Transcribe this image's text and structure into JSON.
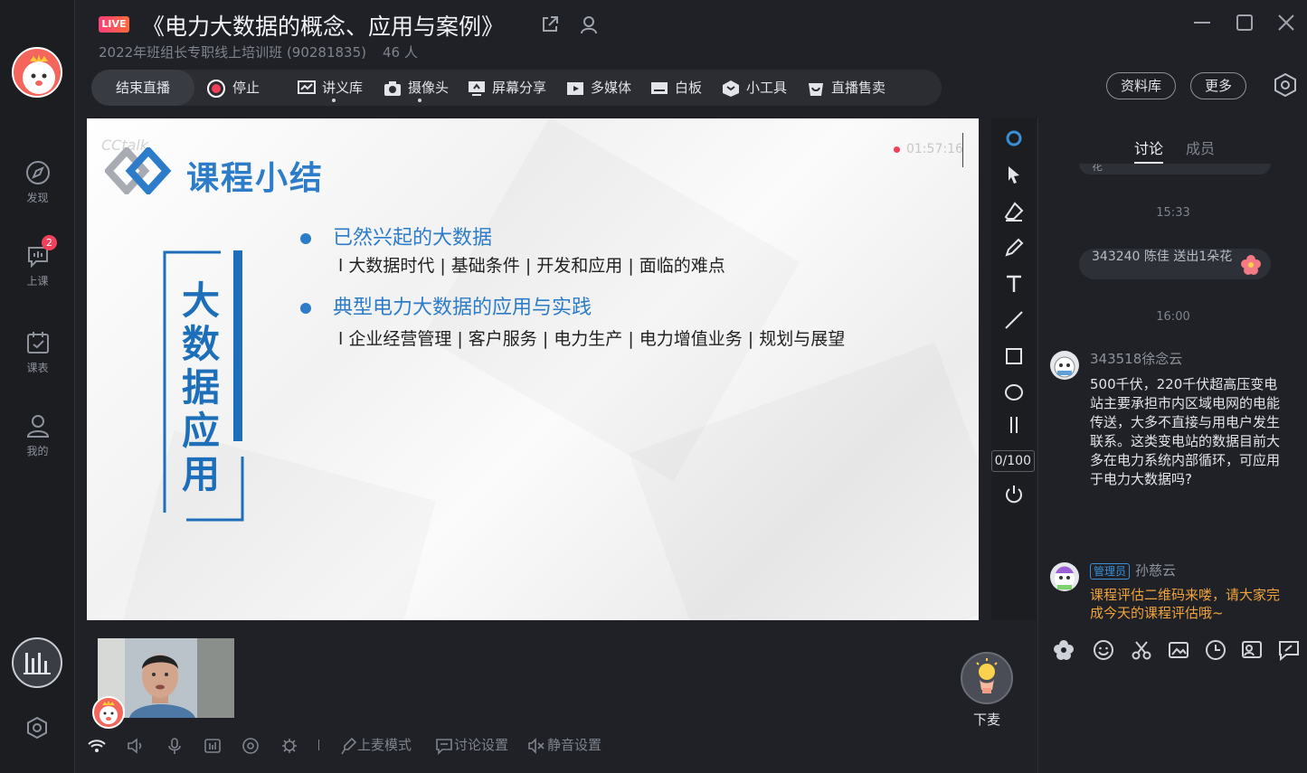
{
  "header": {
    "live_badge": "LIVE",
    "title": "《电力大数据的概念、应用与案例》",
    "subtitle": "2022年班组长专职线上培训班 (90281835)",
    "audience_count": "46 人"
  },
  "sidebar": {
    "items": [
      {
        "label": "发现",
        "icon": "compass-icon"
      },
      {
        "label": "上课",
        "icon": "chat-bubble-icon",
        "badge": "2"
      },
      {
        "label": "课表",
        "icon": "calendar-check-icon"
      },
      {
        "label": "我的",
        "icon": "person-icon"
      }
    ]
  },
  "toolbar": {
    "end_live": "结束直播",
    "stop": "停止",
    "items": [
      {
        "label": "讲义库",
        "icon": "slides-icon"
      },
      {
        "label": "摄像头",
        "icon": "camera-icon"
      },
      {
        "label": "屏幕分享",
        "icon": "screen-share-icon"
      },
      {
        "label": "多媒体",
        "icon": "play-icon"
      },
      {
        "label": "白板",
        "icon": "whiteboard-icon"
      },
      {
        "label": "小工具",
        "icon": "toolbox-icon"
      },
      {
        "label": "直播售卖",
        "icon": "shopping-bag-icon"
      }
    ],
    "library": "资料库",
    "more": "更多"
  },
  "slide": {
    "watermark": "CCtalk",
    "title": "课程小结",
    "recording_time": "01:57:16",
    "vertical_label": "大数据应用",
    "sections": [
      {
        "heading": "已然兴起的大数据",
        "detail": "l 大数据时代 | 基础条件 | 开发和应用 | 面临的难点"
      },
      {
        "heading": "典型电力大数据的应用与实践",
        "detail": "l 企业经营管理 | 客户服务 | 电力生产 | 电力增值业务 | 规划与展望"
      }
    ]
  },
  "drawing_tools": {
    "tools": [
      "circle-cursor-icon",
      "pointer-icon",
      "eraser-icon",
      "pen-icon",
      "text-icon",
      "line-icon",
      "rectangle-icon",
      "ellipse-icon",
      "pause-icon",
      "power-icon"
    ],
    "page_indicator": "0/100"
  },
  "chat": {
    "tabs": [
      "讨论",
      "成员"
    ],
    "active_tab": "讨论",
    "top_fragment": "花",
    "messages": [
      {
        "type": "time",
        "text": "15:33"
      },
      {
        "type": "gift",
        "text": "343240 陈佳 送出1朵花"
      },
      {
        "type": "time",
        "text": "16:00"
      },
      {
        "type": "user",
        "name": "343518徐念云",
        "text": "500千伏，220千伏超高压变电站主要承担市内区域电网的电能传送，大多不直接与用电户发生联系。这类变电站的数据目前大多在电力系统内部循环，可应用于电力大数据吗?"
      },
      {
        "type": "admin",
        "tag": "管理员",
        "name": "孙慈云",
        "text": "课程评估二维码来喽，请大家完成今天的课程评估哦~"
      }
    ],
    "tools": [
      "flower-icon",
      "emoji-icon",
      "scissors-icon",
      "image-icon",
      "clock-icon",
      "screen-people-icon",
      "quick-reply-icon"
    ]
  },
  "bottom": {
    "mic_mode": "上麦模式",
    "discussion_settings": "讨论设置",
    "mute_settings": "静音设置",
    "leave_mic": "下麦"
  },
  "colors": {
    "accent_blue": "#2c7cc9",
    "live_pink": "#ff3d7a",
    "admin_orange": "#f0a33c",
    "background": "#1f2126"
  }
}
